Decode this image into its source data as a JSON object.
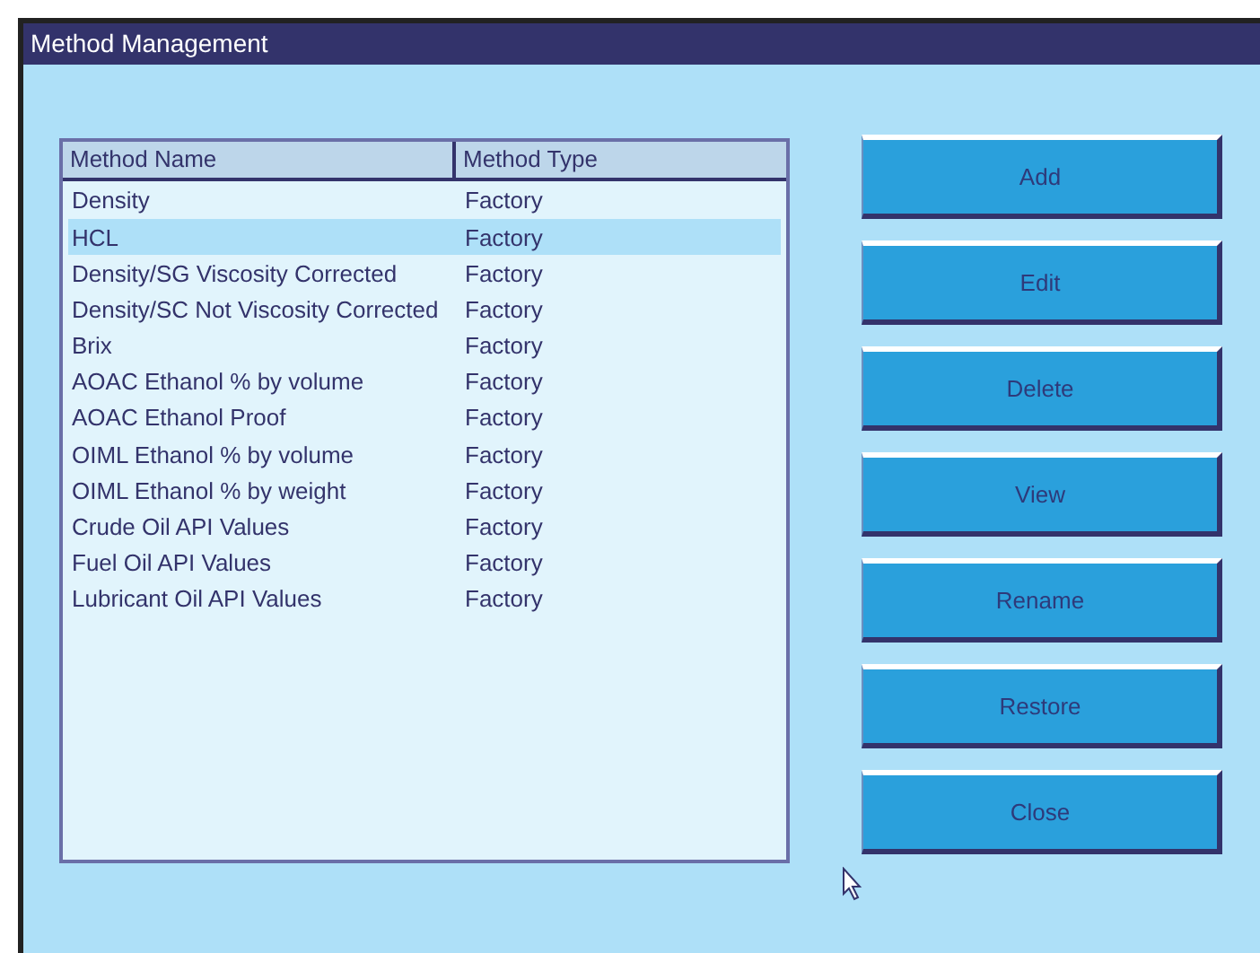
{
  "window": {
    "title": "Method Management"
  },
  "table": {
    "columns": [
      "Method Name",
      "Method Type"
    ],
    "rows": [
      {
        "name": "Density",
        "type": "Factory",
        "selected": false
      },
      {
        "name": "HCL",
        "type": "Factory",
        "selected": true
      },
      {
        "name": "Density/SG Viscosity Corrected",
        "type": "Factory",
        "selected": false
      },
      {
        "name": "Density/SC Not Viscosity Corrected",
        "type": "Factory",
        "selected": false
      },
      {
        "name": "Brix",
        "type": "Factory",
        "selected": false
      },
      {
        "name": "AOAC Ethanol % by volume",
        "type": "Factory",
        "selected": false
      },
      {
        "name": "AOAC Ethanol Proof",
        "type": "Factory",
        "selected": false
      },
      {
        "name": "OIML Ethanol % by volume",
        "type": "Factory",
        "selected": false
      },
      {
        "name": "OIML Ethanol % by weight",
        "type": "Factory",
        "selected": false
      },
      {
        "name": "Crude Oil API Values",
        "type": "Factory",
        "selected": false
      },
      {
        "name": "Fuel Oil API Values",
        "type": "Factory",
        "selected": false
      },
      {
        "name": "Lubricant Oil API Values",
        "type": "Factory",
        "selected": false
      }
    ]
  },
  "buttons": [
    "Add",
    "Edit",
    "Delete",
    "View",
    "Rename",
    "Restore",
    "Close"
  ]
}
